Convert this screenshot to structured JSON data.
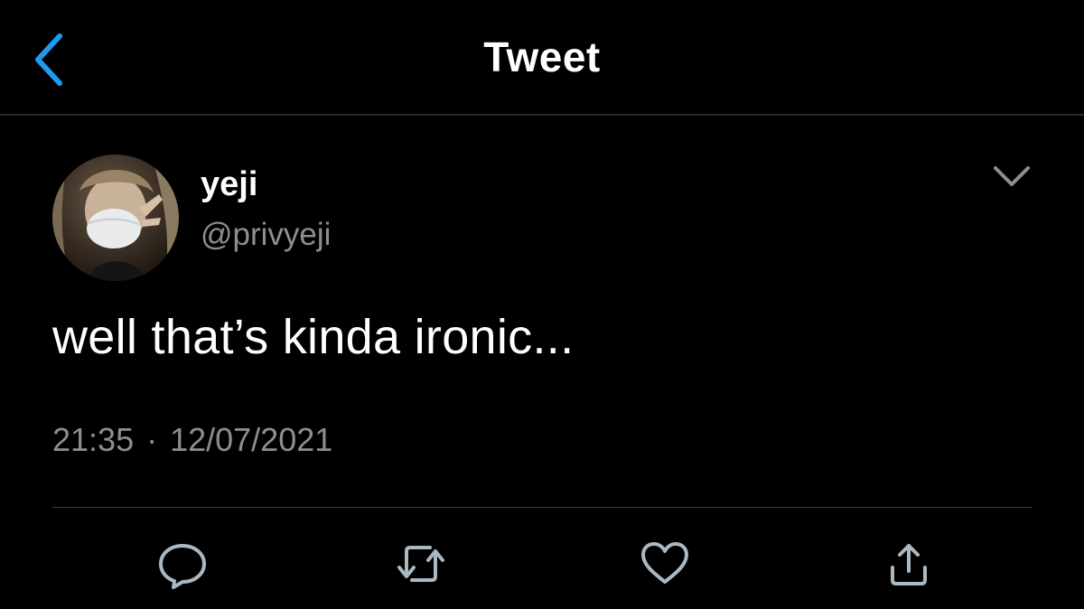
{
  "header": {
    "title": "Tweet",
    "back_icon": "chevron-left-icon"
  },
  "tweet": {
    "author": {
      "display_name": "yeji",
      "handle": "@privyeji"
    },
    "text": "well that’s kinda ironic...",
    "time": "21:35",
    "separator": "·",
    "date": "12/07/2021"
  },
  "actions": [
    {
      "name": "reply",
      "icon": "reply-icon"
    },
    {
      "name": "retweet",
      "icon": "retweet-icon"
    },
    {
      "name": "like",
      "icon": "heart-icon"
    },
    {
      "name": "share",
      "icon": "share-icon"
    }
  ],
  "colors": {
    "background": "#000000",
    "accent": "#1d9bf0",
    "text_primary": "#ffffff",
    "text_secondary": "#8b8f94",
    "icon": "#aab8c2"
  }
}
